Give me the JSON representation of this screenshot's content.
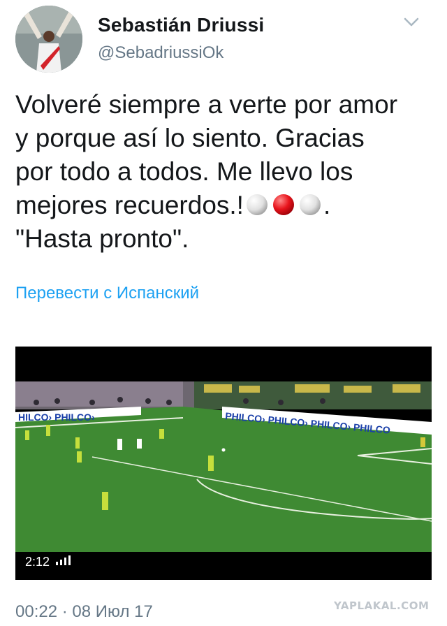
{
  "author": {
    "name": "Sebastián Driussi",
    "handle": "@SebadriussiOk"
  },
  "tweet": {
    "line1": "Volveré siempre a verte por amor",
    "line2": "y porque así lo siento. Gracias",
    "line3": "por todo a todos. Me llevo los",
    "line4_pre": "mejores recuerdos.!",
    "line4_post": ".",
    "line5": "\"Hasta pronto\".",
    "emojis": [
      "white-circle-icon",
      "red-circle-icon",
      "white-circle-icon"
    ]
  },
  "translate_label": "Перевести с Испанский",
  "video": {
    "duration": "2:12",
    "stadium_ad": "PHILCO"
  },
  "timestamp": "00:22 · 08 Июл 17",
  "watermark": "YAPLAKAL.COM",
  "colors": {
    "link": "#1da1f2",
    "secondary_text": "#657786",
    "pitch": "#3f8a33"
  }
}
